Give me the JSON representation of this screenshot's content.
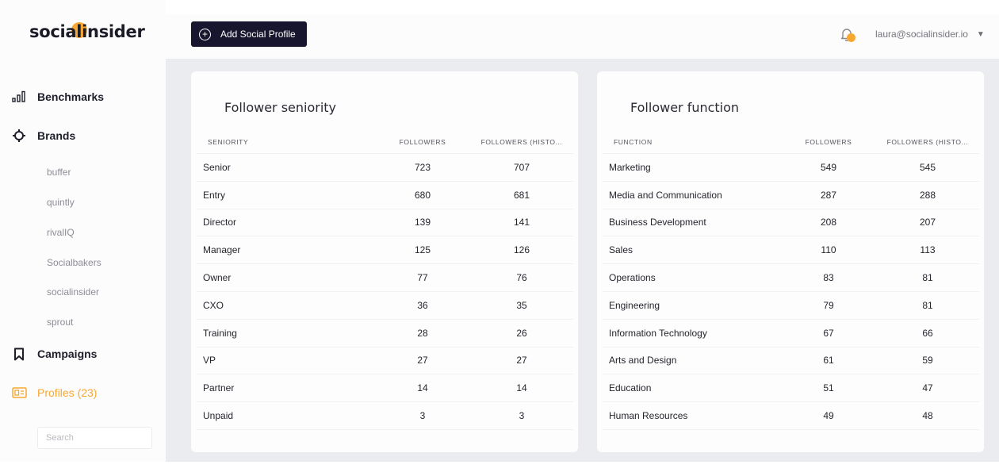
{
  "app": {
    "logo": "socialinsider",
    "brand_color": "#f7a833",
    "dark_color": "#18162e"
  },
  "sidebar": {
    "items": [
      {
        "label": "Benchmarks",
        "icon": "bar-chart-icon"
      },
      {
        "label": "Brands",
        "icon": "crosshair-icon"
      },
      {
        "label": "Campaigns",
        "icon": "bookmark-icon"
      },
      {
        "label": "Profiles (23)",
        "icon": "id-card-icon",
        "active": true
      }
    ],
    "brands": [
      "buffer",
      "quintly",
      "rivalIQ",
      "Socialbakers",
      "socialinsider",
      "sprout"
    ],
    "search_placeholder": "Search"
  },
  "topbar": {
    "add_button": "Add Social Profile",
    "user_email": "laura@socialinsider.io",
    "caret": "▼"
  },
  "seniority": {
    "title": "Follower seniority",
    "headers": [
      "SENIORITY",
      "FOLLOWERS",
      "FOLLOWERS (HISTO..."
    ],
    "rows": [
      [
        "Senior",
        "723",
        "707"
      ],
      [
        "Entry",
        "680",
        "681"
      ],
      [
        "Director",
        "139",
        "141"
      ],
      [
        "Manager",
        "125",
        "126"
      ],
      [
        "Owner",
        "77",
        "76"
      ],
      [
        "CXO",
        "36",
        "35"
      ],
      [
        "Training",
        "28",
        "26"
      ],
      [
        "VP",
        "27",
        "27"
      ],
      [
        "Partner",
        "14",
        "14"
      ],
      [
        "Unpaid",
        "3",
        "3"
      ]
    ]
  },
  "function": {
    "title": "Follower function",
    "headers": [
      "FUNCTION",
      "FOLLOWERS",
      "FOLLOWERS (HISTO..."
    ],
    "rows": [
      [
        "Marketing",
        "549",
        "545"
      ],
      [
        "Media and Communication",
        "287",
        "288"
      ],
      [
        "Business Development",
        "208",
        "207"
      ],
      [
        "Sales",
        "110",
        "113"
      ],
      [
        "Operations",
        "83",
        "81"
      ],
      [
        "Engineering",
        "79",
        "81"
      ],
      [
        "Information Technology",
        "67",
        "66"
      ],
      [
        "Arts and Design",
        "61",
        "59"
      ],
      [
        "Education",
        "51",
        "47"
      ],
      [
        "Human Resources",
        "49",
        "48"
      ]
    ]
  }
}
